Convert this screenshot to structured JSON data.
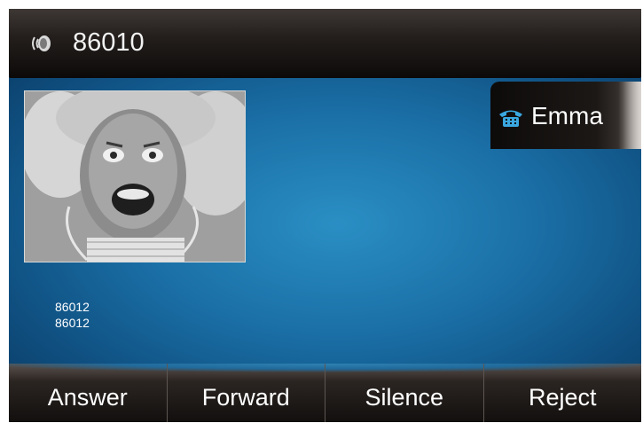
{
  "title_bar": {
    "number": "86010",
    "icon": "speaker-icon"
  },
  "contact": {
    "name": "Emma",
    "icon": "phone-icon"
  },
  "caller": {
    "line1": "86012",
    "line2": "86012"
  },
  "softkeys": [
    {
      "label": "Answer"
    },
    {
      "label": "Forward"
    },
    {
      "label": "Silence"
    },
    {
      "label": "Reject"
    }
  ],
  "colors": {
    "background_blue": "#1a6fa6",
    "bar_dark": "#120f0e",
    "contact_icon": "#3aa7e0"
  }
}
